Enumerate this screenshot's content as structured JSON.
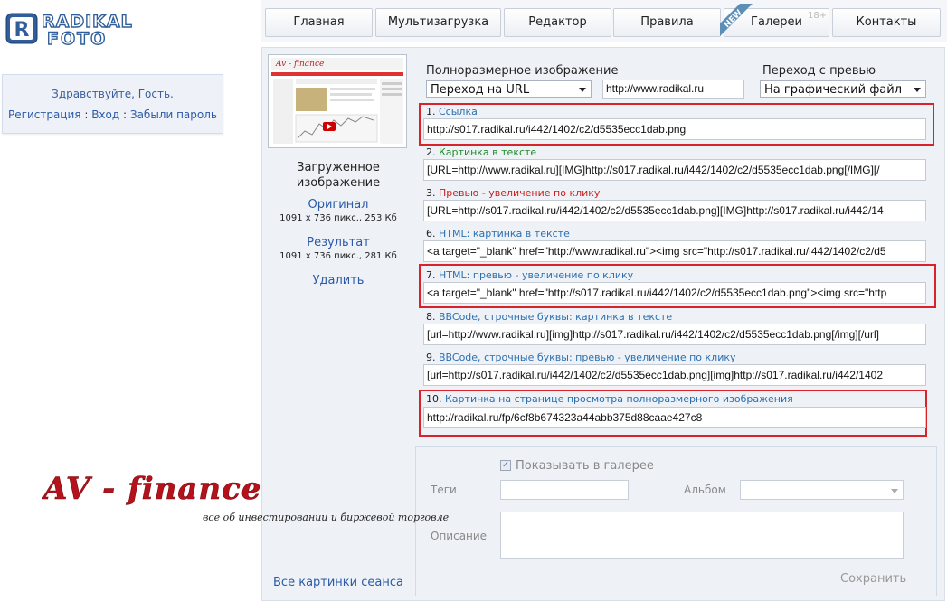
{
  "logo": {
    "text_top": "RADIKAL",
    "text_bottom": "FOTO"
  },
  "greeting": {
    "hello": "Здравствуйте, Гость.",
    "register": "Регистрация",
    "sep": ":",
    "login": "Вход",
    "forgot": "Забыли пароль"
  },
  "nav": {
    "tabs": [
      "Главная",
      "Мультизагрузка",
      "Редактор",
      "Правила",
      "Галереи",
      "Контакты"
    ],
    "new_badge": "NEW",
    "age": "18+"
  },
  "sidebar": {
    "uploaded_line1": "Загруженное",
    "uploaded_line2": "изображение",
    "original": "Оригинал",
    "original_info": "1091 x 736 пикс., 253 Кб",
    "result": "Результат",
    "result_info": "1091 x 736 пикс., 281 Кб",
    "delete": "Удалить",
    "all_session": "Все картинки сеанса"
  },
  "options": {
    "full_label": "Полноразмерное изображение",
    "full_select": "Переход на URL",
    "full_url": "http://www.radikal.ru",
    "preview_label": "Переход с превью",
    "preview_select": "На графический файл"
  },
  "links": [
    {
      "num": "1.",
      "label": "Ссылка",
      "value": "http://s017.radikal.ru/i442/1402/c2/d5535ecc1dab.png"
    },
    {
      "num": "2.",
      "label": "Картинка в тексте",
      "value": "[URL=http://www.radikal.ru][IMG]http://s017.radikal.ru/i442/1402/c2/d5535ecc1dab.png[/IMG][/"
    },
    {
      "num": "3.",
      "label": "Превью - увеличение по клику",
      "value": "[URL=http://s017.radikal.ru/i442/1402/c2/d5535ecc1dab.png][IMG]http://s017.radikal.ru/i442/14"
    },
    {
      "num": "6.",
      "label": "HTML: картинка в тексте",
      "value": "<a target=\"_blank\" href=\"http://www.radikal.ru\"><img src=\"http://s017.radikal.ru/i442/1402/c2/d5"
    },
    {
      "num": "7.",
      "label": "HTML: превью - увеличение по клику",
      "value": "<a target=\"_blank\" href=\"http://s017.radikal.ru/i442/1402/c2/d5535ecc1dab.png\"><img src=\"http"
    },
    {
      "num": "8.",
      "label_prefix": "BBCode,",
      "label": "строчные буквы: картинка в тексте",
      "value": "[url=http://www.radikal.ru][img]http://s017.radikal.ru/i442/1402/c2/d5535ecc1dab.png[/img][/url]"
    },
    {
      "num": "9.",
      "label_prefix": "BBCode,",
      "label": "строчные буквы: превью - увеличение по клику",
      "value": "[url=http://s017.radikal.ru/i442/1402/c2/d5535ecc1dab.png][img]http://s017.radikal.ru/i442/1402"
    },
    {
      "num": "10.",
      "label": "Картинка на странице просмотра полноразмерного изображения",
      "value": "http://radikal.ru/fp/6cf8b674323a44abb375d88caae427c8"
    }
  ],
  "gallery": {
    "show_label": "Показывать в галерее",
    "tags": "Теги",
    "album": "Альбом",
    "description": "Описание",
    "save": "Сохранить"
  },
  "watermark": {
    "brand": "AV - finance",
    "tagline": "все об инвестировании и биржевой торговле"
  },
  "colors": {
    "accent_blue": "#2a5aa8",
    "highlight_red": "#d9232b",
    "panel_bg": "#eef2f7"
  }
}
